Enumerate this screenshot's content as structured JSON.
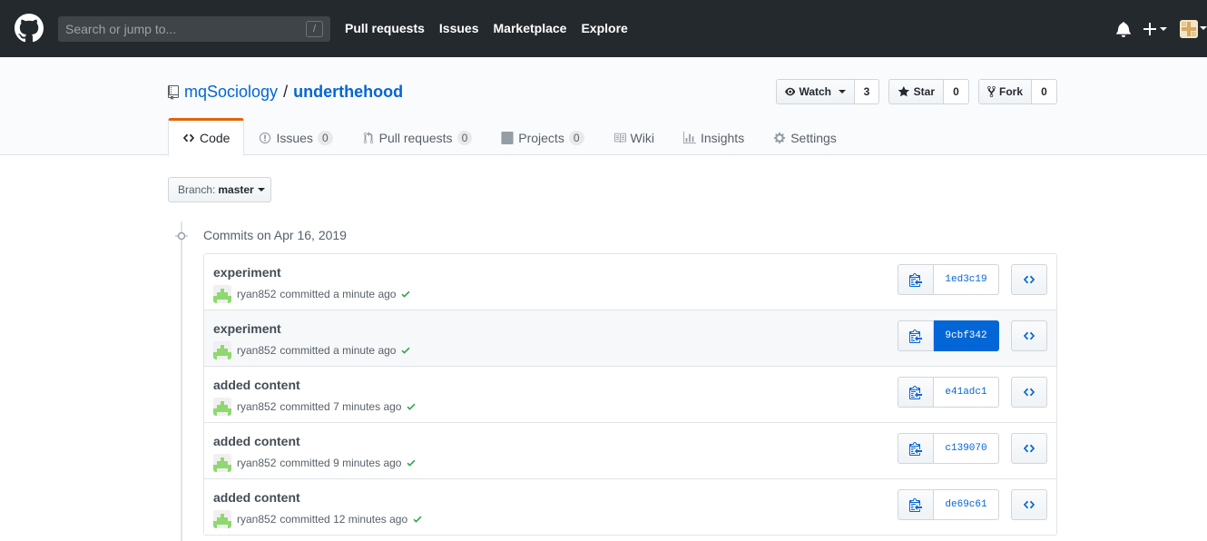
{
  "header": {
    "search_placeholder": "Search or jump to...",
    "search_key": "/",
    "nav": [
      "Pull requests",
      "Issues",
      "Marketplace",
      "Explore"
    ]
  },
  "repo": {
    "owner": "mqSociology",
    "separator": "/",
    "name": "underthehood",
    "watch_label": "Watch",
    "watch_count": "3",
    "star_label": "Star",
    "star_count": "0",
    "fork_label": "Fork",
    "fork_count": "0"
  },
  "tabs": [
    {
      "label": "Code",
      "count": null,
      "icon": "code-icon",
      "selected": true
    },
    {
      "label": "Issues",
      "count": "0",
      "icon": "issue-icon"
    },
    {
      "label": "Pull requests",
      "count": "0",
      "icon": "pull-request-icon"
    },
    {
      "label": "Projects",
      "count": "0",
      "icon": "project-icon"
    },
    {
      "label": "Wiki",
      "count": null,
      "icon": "book-icon"
    },
    {
      "label": "Insights",
      "count": null,
      "icon": "graph-icon"
    },
    {
      "label": "Settings",
      "count": null,
      "icon": "gear-icon"
    }
  ],
  "branch": {
    "label": "Branch:",
    "name": "master"
  },
  "commits_group_title": "Commits on Apr 16, 2019",
  "commits": [
    {
      "title": "experiment",
      "author": "ryan852",
      "action": "committed",
      "time": "a minute ago",
      "sha": "1ed3c19",
      "active": false
    },
    {
      "title": "experiment",
      "author": "ryan852",
      "action": "committed",
      "time": "a minute ago",
      "sha": "9cbf342",
      "active": true
    },
    {
      "title": "added content",
      "author": "ryan852",
      "action": "committed",
      "time": "7 minutes ago",
      "sha": "e41adc1",
      "active": false
    },
    {
      "title": "added content",
      "author": "ryan852",
      "action": "committed",
      "time": "9 minutes ago",
      "sha": "c139070",
      "active": false
    },
    {
      "title": "added content",
      "author": "ryan852",
      "action": "committed",
      "time": "12 minutes ago",
      "sha": "de69c61",
      "active": false
    }
  ],
  "colors": {
    "header_bg": "#24292e",
    "link": "#0366d6",
    "selected_tab_accent": "#e36209",
    "success": "#28a745"
  }
}
